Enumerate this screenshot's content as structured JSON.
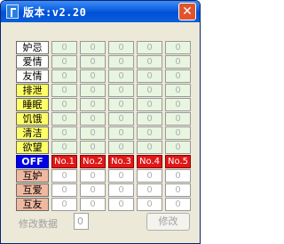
{
  "window": {
    "title": "版本:v2.20",
    "close_glyph": "✕"
  },
  "columns": [
    "No.1",
    "No.2",
    "No.3",
    "No.4",
    "No.5"
  ],
  "stat_rows": [
    {
      "label": "妒忌",
      "style": "white",
      "values": [
        "0",
        "0",
        "0",
        "0",
        "0"
      ]
    },
    {
      "label": "爱情",
      "style": "white",
      "values": [
        "0",
        "0",
        "0",
        "0",
        "0"
      ]
    },
    {
      "label": "友情",
      "style": "white",
      "values": [
        "0",
        "0",
        "0",
        "0",
        "0"
      ]
    },
    {
      "label": "排泄",
      "style": "yellow",
      "values": [
        "0",
        "0",
        "0",
        "0",
        "0"
      ]
    },
    {
      "label": "睡眠",
      "style": "yellow",
      "values": [
        "0",
        "0",
        "0",
        "0",
        "0"
      ]
    },
    {
      "label": "饥饿",
      "style": "yellow",
      "values": [
        "0",
        "0",
        "0",
        "0",
        "0"
      ]
    },
    {
      "label": "清洁",
      "style": "yellow",
      "values": [
        "0",
        "0",
        "0",
        "0",
        "0"
      ]
    },
    {
      "label": "欲望",
      "style": "yellow",
      "values": [
        "0",
        "0",
        "0",
        "0",
        "0"
      ]
    }
  ],
  "off_label": "OFF",
  "mutual_rows": [
    {
      "label": "互妒",
      "values": [
        "0",
        "0",
        "0",
        "0",
        "0"
      ]
    },
    {
      "label": "互爱",
      "values": [
        "0",
        "0",
        "0",
        "0",
        "0"
      ]
    },
    {
      "label": "互友",
      "values": [
        "0",
        "0",
        "0",
        "0",
        "0"
      ]
    }
  ],
  "footer": {
    "label": "修改数据",
    "input_value": "0",
    "button_label": "修改"
  },
  "colors": {
    "title_bar": "#0a5fe0",
    "close_button": "#e0542d",
    "off_background": "#0000e6",
    "column_header": "#e01818",
    "yellow_label": "#ffff66",
    "salmon_label": "#f0b8a0",
    "green_cell": "#e8f5e0"
  }
}
